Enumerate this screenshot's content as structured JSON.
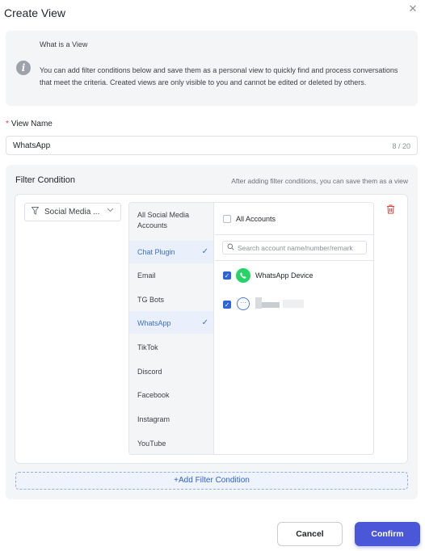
{
  "dialog": {
    "title": "Create View",
    "close_icon": "close-icon"
  },
  "info": {
    "title": "What is a View",
    "icon": "info-icon",
    "text": "You can add filter conditions below and save them as a personal view to quickly find and process conversations that meet the criteria. Created views are only visible to you and cannot be edited or deleted by others."
  },
  "view_name": {
    "required_mark": "*",
    "label": "View Name",
    "value": "WhatsApp",
    "counter": "8 / 20"
  },
  "filter": {
    "title": "Filter Condition",
    "hint": "After adding filter conditions, you can save them as a view",
    "condition_select": "Social Media ...",
    "platforms": [
      {
        "label": "All Social Media Accounts",
        "selected": false
      },
      {
        "label": "Chat Plugin",
        "selected": true
      },
      {
        "label": "Email",
        "selected": false
      },
      {
        "label": "TG Bots",
        "selected": false
      },
      {
        "label": "WhatsApp",
        "selected": true
      },
      {
        "label": "TikTok",
        "selected": false
      },
      {
        "label": "Discord",
        "selected": false
      },
      {
        "label": "Facebook",
        "selected": false
      },
      {
        "label": "Instagram",
        "selected": false
      },
      {
        "label": "YouTube",
        "selected": false
      }
    ],
    "all_accounts_label": "All Accounts",
    "search_placeholder": "Search account name/number/remark",
    "accounts": [
      {
        "label": "WhatsApp Device",
        "checked": true,
        "icon": "whatsapp-icon"
      },
      {
        "label": "",
        "checked": true,
        "icon": "chat-bubble-icon"
      }
    ],
    "add_condition_label": "+Add Filter Condition"
  },
  "footer": {
    "cancel_label": "Cancel",
    "confirm_label": "Confirm"
  },
  "colors": {
    "accent": "#2f63d8",
    "confirm": "#4a57d9",
    "danger": "#e0443c",
    "whatsapp": "#25d366"
  }
}
